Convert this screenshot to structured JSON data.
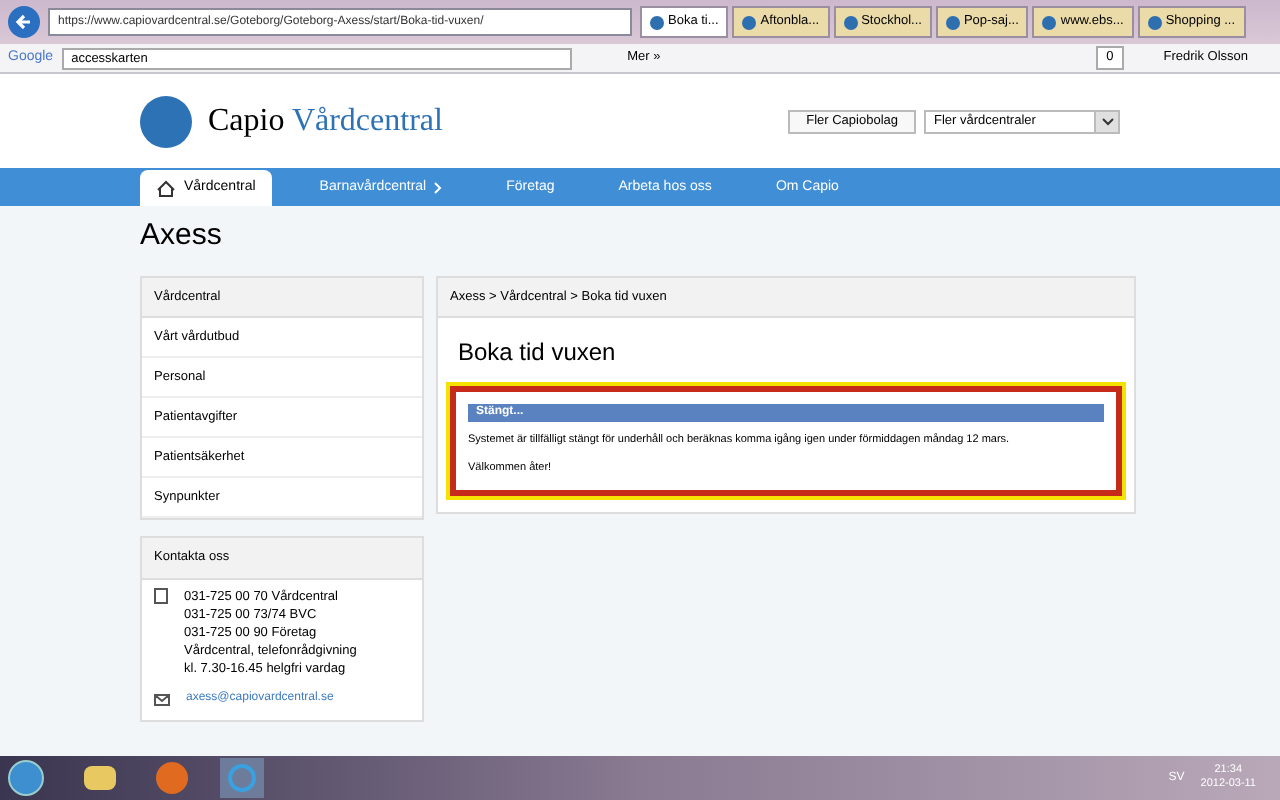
{
  "browser": {
    "url": "https://www.capiovardcentral.se/Goteborg/Goteborg-Axess/start/Boka-tid-vuxen/",
    "tabs": [
      {
        "label": "Boka ti...",
        "selected": true
      },
      {
        "label": "Aftonbla...",
        "selected": false
      },
      {
        "label": "Stockhol...",
        "selected": false
      },
      {
        "label": "Pop-saj...",
        "selected": false
      },
      {
        "label": "www.ebs...",
        "selected": false
      },
      {
        "label": "Shopping ...",
        "selected": false
      }
    ],
    "toolbar": {
      "brand": "Google",
      "search": "accesskarten",
      "more": "Mer »",
      "count": "0",
      "user": "Fredrik Olsson"
    }
  },
  "site": {
    "logo": "Capio",
    "logo_accent": "Vårdcentral",
    "button": "Fler Capiobolag",
    "select": "Fler vårdcentraler",
    "nav": [
      {
        "label": "Vårdcentral",
        "selected": true,
        "submenu": false
      },
      {
        "label": "Barnavårdcentral",
        "selected": false,
        "submenu": true
      },
      {
        "label": "Företag",
        "selected": false,
        "submenu": false
      },
      {
        "label": "Arbeta hos oss",
        "selected": false,
        "submenu": false
      },
      {
        "label": "Om Capio",
        "selected": false,
        "submenu": false
      }
    ],
    "heading": "Axess",
    "sidebar": {
      "title": "Vårdcentral",
      "items": [
        "Vårt vårdutbud",
        "Personal",
        "Patientavgifter",
        "Patientsäkerhet",
        "Synpunkter"
      ]
    },
    "contact": {
      "title": "Kontakta oss",
      "lines": [
        "031-725 00 70 Vårdcentral",
        "031-725 00 73/74 BVC",
        "031-725 00 90 Företag",
        "Vårdcentral, telefonrådgivning",
        "kl. 7.30-16.45 helgfri vardag"
      ],
      "email": "axess@capiovardcentral.se"
    },
    "breadcrumb": "Axess > Vårdcentral > Boka tid vuxen",
    "title": "Boka tid vuxen",
    "notice": {
      "title": "Stängt...",
      "text": "Systemet är tillfälligt stängt för underhåll och beräknas komma igång igen under förmiddagen måndag 12 mars.",
      "closing": "Välkommen åter!"
    }
  },
  "taskbar": {
    "language": "SV",
    "time": "21:34",
    "date": "2012-03-11"
  }
}
